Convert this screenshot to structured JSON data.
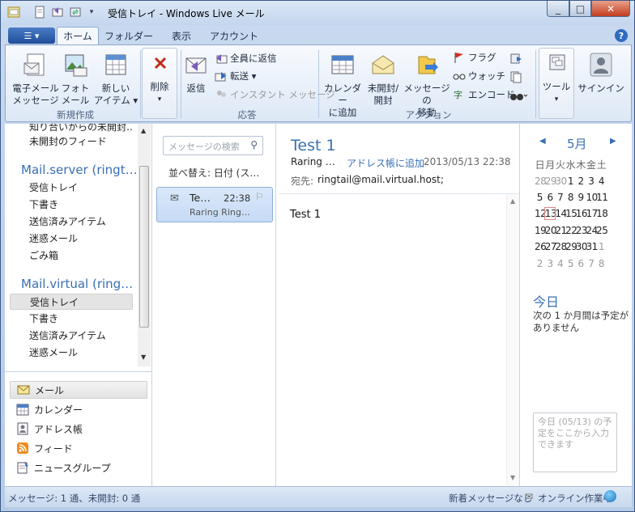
{
  "window": {
    "title": "受信トレイ - Windows Live メール",
    "minimize": "_",
    "maximize": "□",
    "close": "✕"
  },
  "ribbon": {
    "menu_button": "☰ ▾",
    "tabs": [
      {
        "label": "ホーム",
        "active": true
      },
      {
        "label": "フォルダー",
        "active": false
      },
      {
        "label": "表示",
        "active": false
      },
      {
        "label": "アカウント",
        "active": false
      }
    ],
    "help": "?",
    "new_group": {
      "label": "新規作成",
      "email": "電子メール\nメッセージ",
      "email_l1": "電子メール",
      "email_l2": "メッセージ",
      "photo_l1": "フォト",
      "photo_l2": "メール",
      "item_l1": "新しい",
      "item_l2": "アイテム ▾"
    },
    "delete": {
      "label": "削除",
      "arrow": "▾"
    },
    "respond_group": {
      "label": "応答",
      "reply": "返信",
      "reply_all": "全員に返信",
      "forward": "転送 ▾",
      "instant_message": "インスタント メッセージ"
    },
    "actions_group": {
      "label": "アクション",
      "calendar_l1": "カレンダー",
      "calendar_l2": "に追加",
      "unread_l1": "未開封/",
      "unread_l2": "開封",
      "move_l1": "メッセージの",
      "move_l2": "移動",
      "flag": "フラグ",
      "watch": "ウォッチ",
      "encode": "エンコード"
    },
    "tools": {
      "label": "ツール",
      "arrow": "▾"
    },
    "signin": {
      "label": "サインイン"
    }
  },
  "folders": {
    "top_items": [
      "知り合いからの未開封…",
      "未開封のフィード"
    ],
    "account1": {
      "name": "Mail.server (ringt…",
      "items": [
        "受信トレイ",
        "下書き",
        "送信済みアイテム",
        "迷惑メール",
        "ごみ箱"
      ]
    },
    "account2": {
      "name": "Mail.virtual (ring…",
      "items": [
        "受信トレイ",
        "下書き",
        "送信済みアイテム",
        "迷惑メール"
      ]
    }
  },
  "nav": {
    "items": [
      {
        "label": "メール",
        "icon": "mail-icon",
        "selected": true
      },
      {
        "label": "カレンダー",
        "icon": "calendar-icon",
        "selected": false
      },
      {
        "label": "アドレス帳",
        "icon": "contacts-icon",
        "selected": false
      },
      {
        "label": "フィード",
        "icon": "feed-icon",
        "selected": false
      },
      {
        "label": "ニュースグループ",
        "icon": "newsgroup-icon",
        "selected": false
      }
    ]
  },
  "message_list": {
    "search_placeholder": "メッセージの検索",
    "sort_label": "並べ替え: 日付 (ス…",
    "messages": [
      {
        "subject": "Te…",
        "time": "22:38",
        "from": "Raring Ring…"
      }
    ]
  },
  "reading_pane": {
    "subject": "Test 1",
    "from": "Raring …",
    "add_contact": "アドレス帳に追加",
    "date": "2013/05/13 22:38",
    "to_label": "宛先:",
    "to": "ringtail@mail.virtual.host;",
    "body": "Test 1"
  },
  "calendar": {
    "month": "5月",
    "prev": "◀",
    "next": "▶",
    "weekdays": [
      "日",
      "月",
      "火",
      "水",
      "木",
      "金",
      "土"
    ],
    "weeks": [
      [
        "28",
        "29",
        "30",
        "1",
        "2",
        "3",
        "4"
      ],
      [
        "5",
        "6",
        "7",
        "8",
        "9",
        "10",
        "11"
      ],
      [
        "12",
        "13",
        "14",
        "15",
        "16",
        "17",
        "18"
      ],
      [
        "19",
        "20",
        "21",
        "22",
        "23",
        "24",
        "25"
      ],
      [
        "26",
        "27",
        "28",
        "29",
        "30",
        "31",
        "1"
      ],
      [
        "2",
        "3",
        "4",
        "5",
        "6",
        "7",
        "8"
      ]
    ],
    "today_day": "13",
    "today_title": "今日",
    "today_note": "次の 1 か月間は予定がありません",
    "quick_add_placeholder": "今日 (05/13) の予定をここから入力できます"
  },
  "status": {
    "left": "メッセージ: 1 通、未開封: 0 通",
    "new_messages": "新着メッセージなし",
    "online": "オンライン作業中"
  },
  "colors": {
    "accent": "#3a6fb4",
    "selection": "#c5daf5"
  }
}
